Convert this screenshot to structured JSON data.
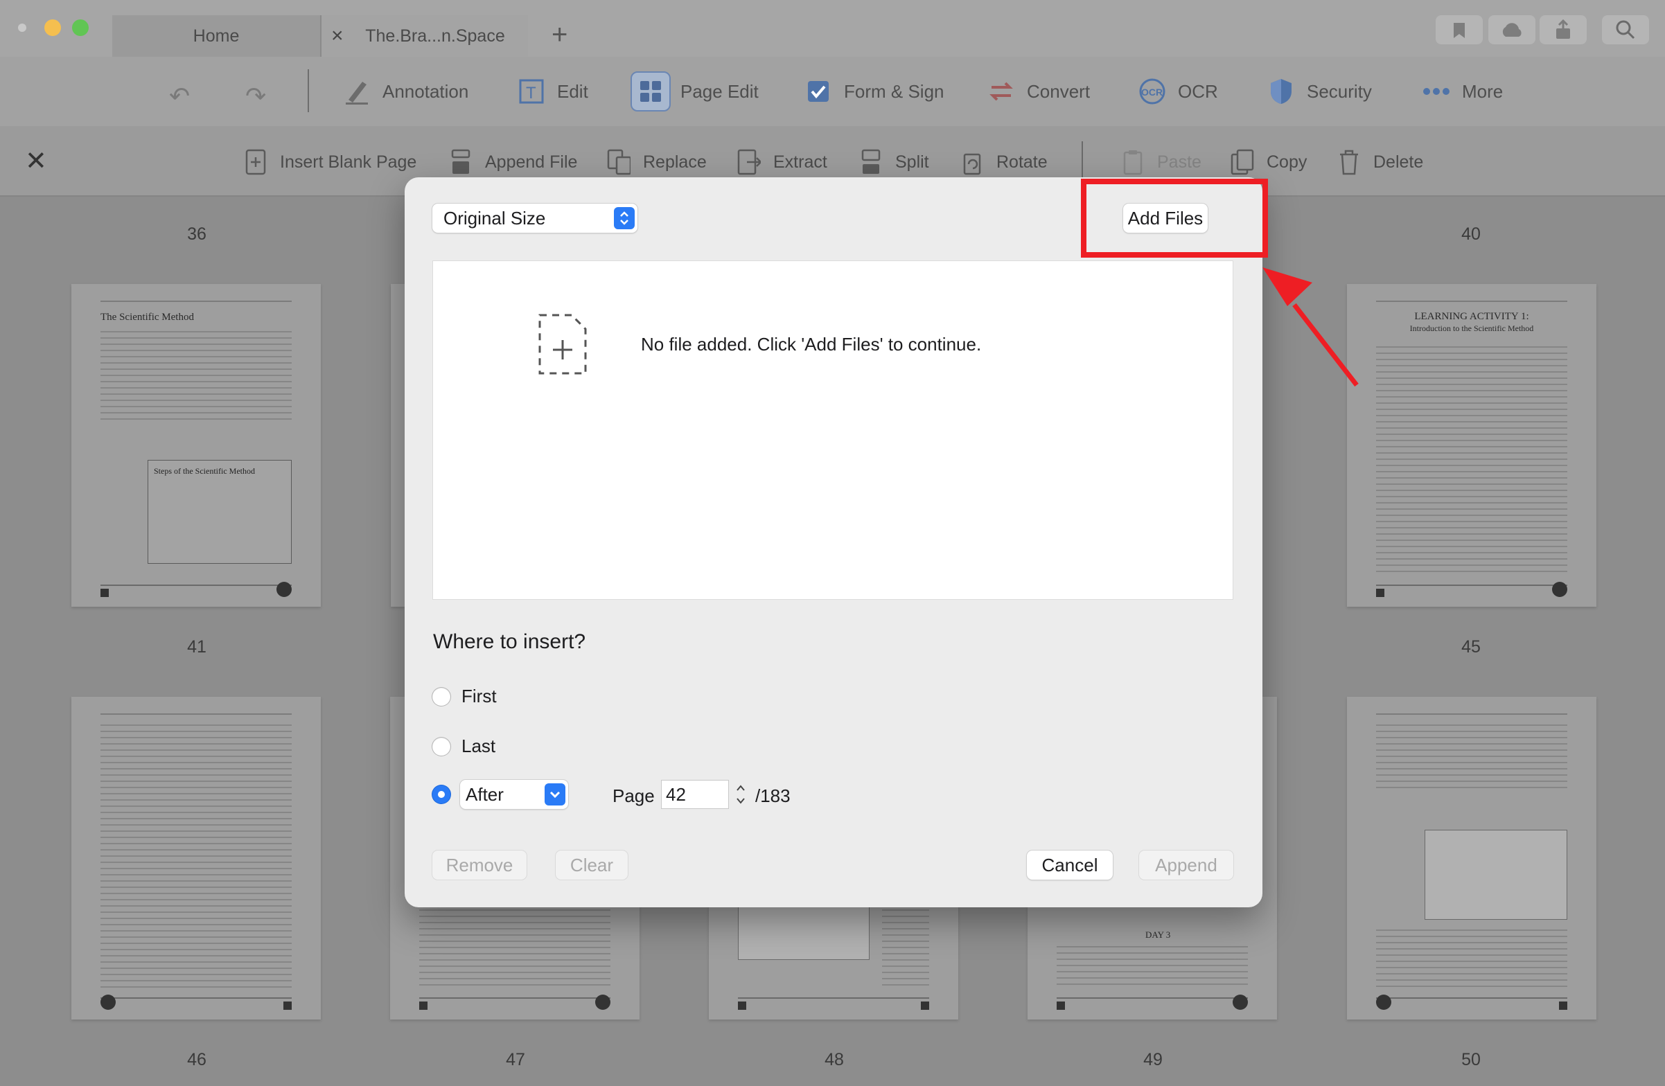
{
  "window": {
    "tabs": [
      {
        "label": "Home"
      },
      {
        "label": "The.Bra...n.Space"
      }
    ],
    "new_tab_label": "+"
  },
  "toolbar": {
    "items": [
      {
        "label": "Annotation",
        "icon": "annotation-icon"
      },
      {
        "label": "Edit",
        "icon": "edit-icon"
      },
      {
        "label": "Page Edit",
        "icon": "page-edit-icon"
      },
      {
        "label": "Form & Sign",
        "icon": "form-sign-icon"
      },
      {
        "label": "Convert",
        "icon": "convert-icon"
      },
      {
        "label": "OCR",
        "icon": "ocr-icon"
      },
      {
        "label": "Security",
        "icon": "security-icon"
      },
      {
        "label": "More",
        "icon": "more-icon"
      }
    ],
    "ocr_badge": "OCR"
  },
  "page_edit_toolbar": {
    "items": [
      {
        "label": "Insert Blank Page"
      },
      {
        "label": "Append File"
      },
      {
        "label": "Replace"
      },
      {
        "label": "Extract"
      },
      {
        "label": "Split"
      },
      {
        "label": "Rotate"
      },
      {
        "label": "Paste"
      },
      {
        "label": "Copy"
      },
      {
        "label": "Delete"
      }
    ]
  },
  "pages": {
    "top_numbers": [
      "36",
      "40"
    ],
    "mid_numbers": [
      "41",
      "45"
    ],
    "bottom_numbers": [
      "46",
      "47",
      "48",
      "49",
      "50"
    ],
    "thumb_titles": {
      "left": "The Scientific Method",
      "left_box": "Steps of the Scientific Method",
      "right_line1": "LEARNING ACTIVITY 1:",
      "right_line2": "Introduction to the Scientific Method",
      "day3": "DAY 3"
    }
  },
  "dialog": {
    "size_select": "Original Size",
    "add_files_label": "Add Files",
    "empty_message": "No file added. Click 'Add Files' to continue.",
    "insert_title": "Where to insert?",
    "options": {
      "first": "First",
      "last": "Last",
      "after": "After",
      "selected": "After"
    },
    "page_label": "Page",
    "page_value": "42",
    "page_total": "/183",
    "buttons": {
      "remove": "Remove",
      "clear": "Clear",
      "cancel": "Cancel",
      "append": "Append"
    }
  },
  "colors": {
    "accent": "#2a7bf6",
    "highlight": "#ee1e24"
  }
}
